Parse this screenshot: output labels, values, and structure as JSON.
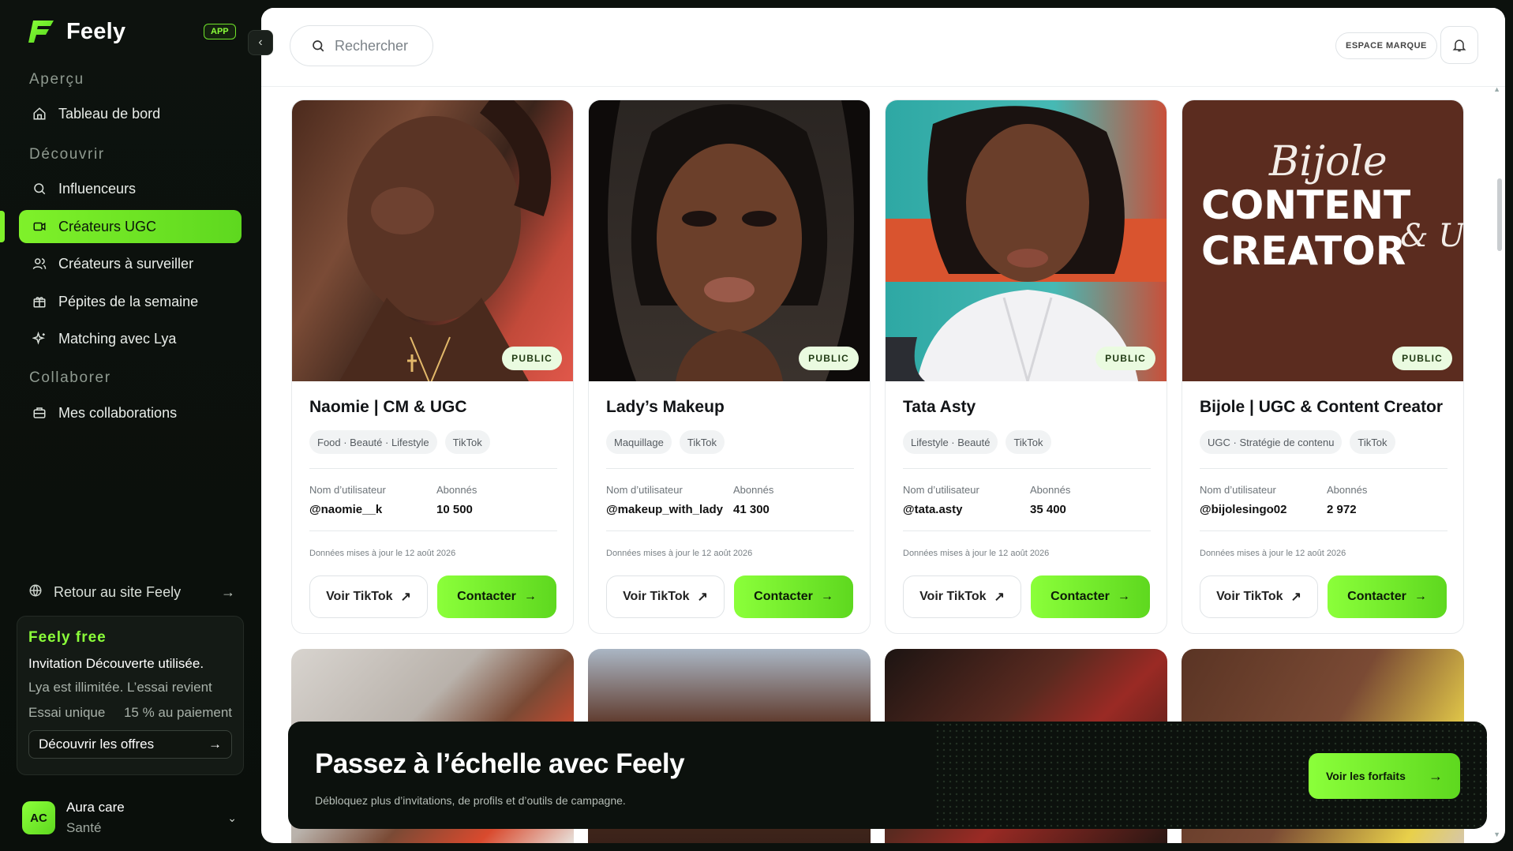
{
  "brand": {
    "name": "Feely",
    "badge": "APP"
  },
  "sidebar": {
    "sections": [
      {
        "title": "Aperçu"
      },
      {
        "title": "Découvrir"
      },
      {
        "title": "Collaborer"
      }
    ],
    "items": [
      {
        "label": "Tableau de bord",
        "icon": "home-icon"
      },
      {
        "label": "Influenceurs",
        "icon": "search-icon"
      },
      {
        "label": "Créateurs UGC",
        "icon": "video-icon",
        "active": true
      },
      {
        "label": "Créateurs à surveiller",
        "icon": "users-icon"
      },
      {
        "label": "Pépites de la semaine",
        "icon": "gift-icon"
      },
      {
        "label": "Matching avec Lya",
        "icon": "sparkles-icon"
      },
      {
        "label": "Mes collaborations",
        "icon": "briefcase-icon"
      }
    ],
    "back_link": "Retour au site Feely",
    "plan": {
      "title": "Feely free",
      "subtitle": "Invitation Découverte utilisée.",
      "text": "Lya est illimitée. L’essai revient",
      "trial_label": "Essai unique",
      "trial_value": "15 % au paiement",
      "button": "Découvrir les offres"
    },
    "account": {
      "initials": "AC",
      "name": "Aura care",
      "category": "Santé"
    }
  },
  "topbar": {
    "search_placeholder": "Rechercher",
    "espace_button": "ESPACE MARQUE"
  },
  "cards": [
    {
      "name": "Naomie | CM & UGC",
      "badge": "PUBLIC",
      "tags": [
        "Food · Beauté · Lifestyle",
        "TikTok"
      ],
      "username_label": "Nom d’utilisateur",
      "username": "@naomie__k",
      "followers_label": "Abonnés",
      "followers": "10 500",
      "updated": "Données mises à jour le 12 août 2026",
      "btn_view": "Voir TikTok",
      "btn_contact": "Contacter"
    },
    {
      "name": "Lady’s Makeup",
      "badge": "PUBLIC",
      "tags": [
        "Maquillage",
        "TikTok"
      ],
      "username_label": "Nom d’utilisateur",
      "username": "@makeup_with_lady",
      "followers_label": "Abonnés",
      "followers": "41 300",
      "updated": "Données mises à jour le 12 août 2026",
      "btn_view": "Voir TikTok",
      "btn_contact": "Contacter"
    },
    {
      "name": "Tata Asty",
      "badge": "PUBLIC",
      "tags": [
        "Lifestyle · Beauté",
        "TikTok"
      ],
      "username_label": "Nom d’utilisateur",
      "username": "@tata.asty",
      "followers_label": "Abonnés",
      "followers": "35 400",
      "updated": "Données mises à jour le 12 août 2026",
      "btn_view": "Voir TikTok",
      "btn_contact": "Contacter"
    },
    {
      "name": "Bijole | UGC & Content Creator",
      "badge": "PUBLIC",
      "tags": [
        "UGC · Stratégie de contenu",
        "TikTok"
      ],
      "username_label": "Nom d’utilisateur",
      "username": "@bijolesingo02",
      "followers_label": "Abonnés",
      "followers": "2 972",
      "updated": "Données mises à jour le 12 août 2026",
      "btn_view": "Voir TikTok",
      "btn_contact": "Contacter",
      "photo_text": [
        "Bijole",
        "CONTENT",
        "CREATOR",
        "& U"
      ]
    }
  ],
  "promo": {
    "title": "Passez à l’échelle avec Feely",
    "subtitle": "Débloquez plus d’invitations, de profils et d’outils de campagne.",
    "button": "Voir les forfaits"
  },
  "colors": {
    "accent": "#7ff12a",
    "sidebar_bg": "#0c110d",
    "promo_bg": "#0c110d"
  }
}
